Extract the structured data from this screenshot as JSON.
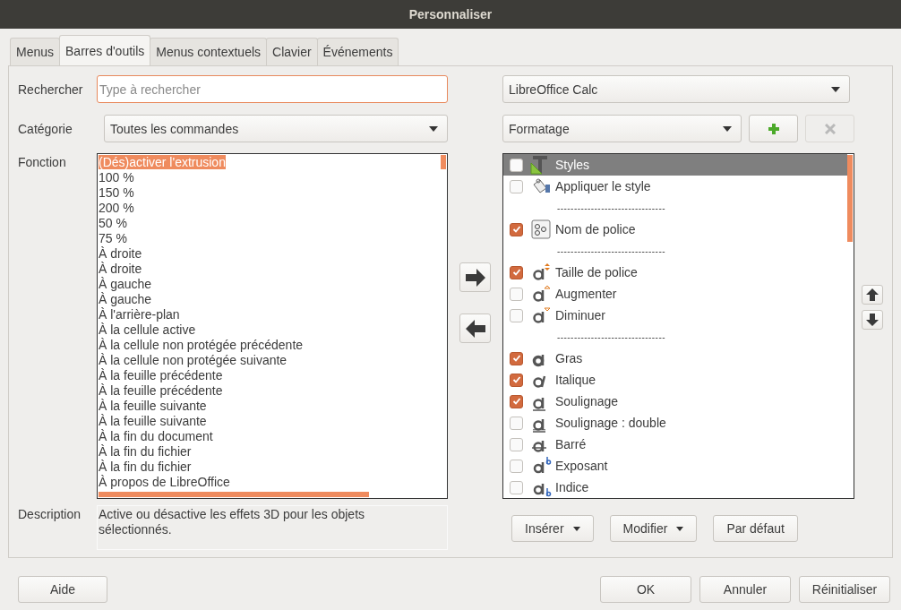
{
  "window": {
    "title": "Personnaliser"
  },
  "tabs": [
    {
      "label": "Menus",
      "selected": false
    },
    {
      "label": "Barres d'outils",
      "selected": true
    },
    {
      "label": "Menus contextuels",
      "selected": false
    },
    {
      "label": "Clavier",
      "selected": false
    },
    {
      "label": "Événements",
      "selected": false
    }
  ],
  "search": {
    "label": "Rechercher",
    "placeholder": "Type à rechercher"
  },
  "category": {
    "label": "Catégorie",
    "value": "Toutes les commandes"
  },
  "functions": {
    "label": "Fonction",
    "items": [
      {
        "label": "(Dés)activer l'extrusion",
        "selected": true
      },
      {
        "label": "100 %",
        "selected": false
      },
      {
        "label": "150 %",
        "selected": false
      },
      {
        "label": "200 %",
        "selected": false
      },
      {
        "label": "50 %",
        "selected": false
      },
      {
        "label": "75 %",
        "selected": false
      },
      {
        "label": "À droite",
        "selected": false
      },
      {
        "label": "À droite",
        "selected": false
      },
      {
        "label": "À gauche",
        "selected": false
      },
      {
        "label": "À gauche",
        "selected": false
      },
      {
        "label": "À l'arrière-plan",
        "selected": false
      },
      {
        "label": "À la cellule active",
        "selected": false
      },
      {
        "label": "À la cellule non protégée précédente",
        "selected": false
      },
      {
        "label": "À la cellule non protégée suivante",
        "selected": false
      },
      {
        "label": "À la feuille précédente",
        "selected": false
      },
      {
        "label": "À la feuille précédente",
        "selected": false
      },
      {
        "label": "À la feuille suivante",
        "selected": false
      },
      {
        "label": "À la feuille suivante",
        "selected": false
      },
      {
        "label": "À la fin du document",
        "selected": false
      },
      {
        "label": "À la fin du fichier",
        "selected": false
      },
      {
        "label": "À la fin du fichier",
        "selected": false
      },
      {
        "label": "À propos de LibreOffice",
        "selected": false
      }
    ]
  },
  "description": {
    "label": "Description",
    "text": "Active ou désactive les effets 3D pour les objets sélectionnés."
  },
  "scope": {
    "value": "LibreOffice Calc"
  },
  "toolbar": {
    "value": "Formatage"
  },
  "toolbar_buttons": [
    {
      "kind": "add",
      "disabled": false
    },
    {
      "kind": "remove",
      "disabled": true
    }
  ],
  "move_buttons": [
    {
      "kind": "right"
    },
    {
      "kind": "left"
    }
  ],
  "entries": [
    {
      "kind": "command",
      "label": "Styles",
      "checked": false,
      "selected": true
    },
    {
      "kind": "command",
      "label": "Appliquer le style",
      "checked": false,
      "selected": false
    },
    {
      "kind": "separator",
      "label": "--------------------------------"
    },
    {
      "kind": "command",
      "label": "Nom de police",
      "checked": true,
      "selected": false
    },
    {
      "kind": "separator",
      "label": "--------------------------------"
    },
    {
      "kind": "command",
      "label": "Taille de police",
      "checked": true,
      "selected": false
    },
    {
      "kind": "command",
      "label": "Augmenter",
      "checked": false,
      "selected": false
    },
    {
      "kind": "command",
      "label": "Diminuer",
      "checked": false,
      "selected": false
    },
    {
      "kind": "separator",
      "label": "--------------------------------"
    },
    {
      "kind": "command",
      "label": "Gras",
      "checked": true,
      "selected": false
    },
    {
      "kind": "command",
      "label": "Italique",
      "checked": true,
      "selected": false
    },
    {
      "kind": "command",
      "label": "Soulignage",
      "checked": true,
      "selected": false
    },
    {
      "kind": "command",
      "label": "Soulignage : double",
      "checked": false,
      "selected": false
    },
    {
      "kind": "command",
      "label": "Barré",
      "checked": false,
      "selected": false
    },
    {
      "kind": "command",
      "label": "Exposant",
      "checked": false,
      "selected": false
    },
    {
      "kind": "command",
      "label": "Indice",
      "checked": false,
      "selected": false
    }
  ],
  "order_buttons": [
    {
      "kind": "up"
    },
    {
      "kind": "down"
    }
  ],
  "entry_buttons": [
    {
      "label": "Insérer",
      "menu": true
    },
    {
      "label": "Modifier",
      "menu": true
    },
    {
      "label": "Par défaut",
      "menu": false
    }
  ],
  "footer": {
    "help": "Aide",
    "buttons": [
      "OK",
      "Annuler",
      "Réinitialiser"
    ]
  }
}
